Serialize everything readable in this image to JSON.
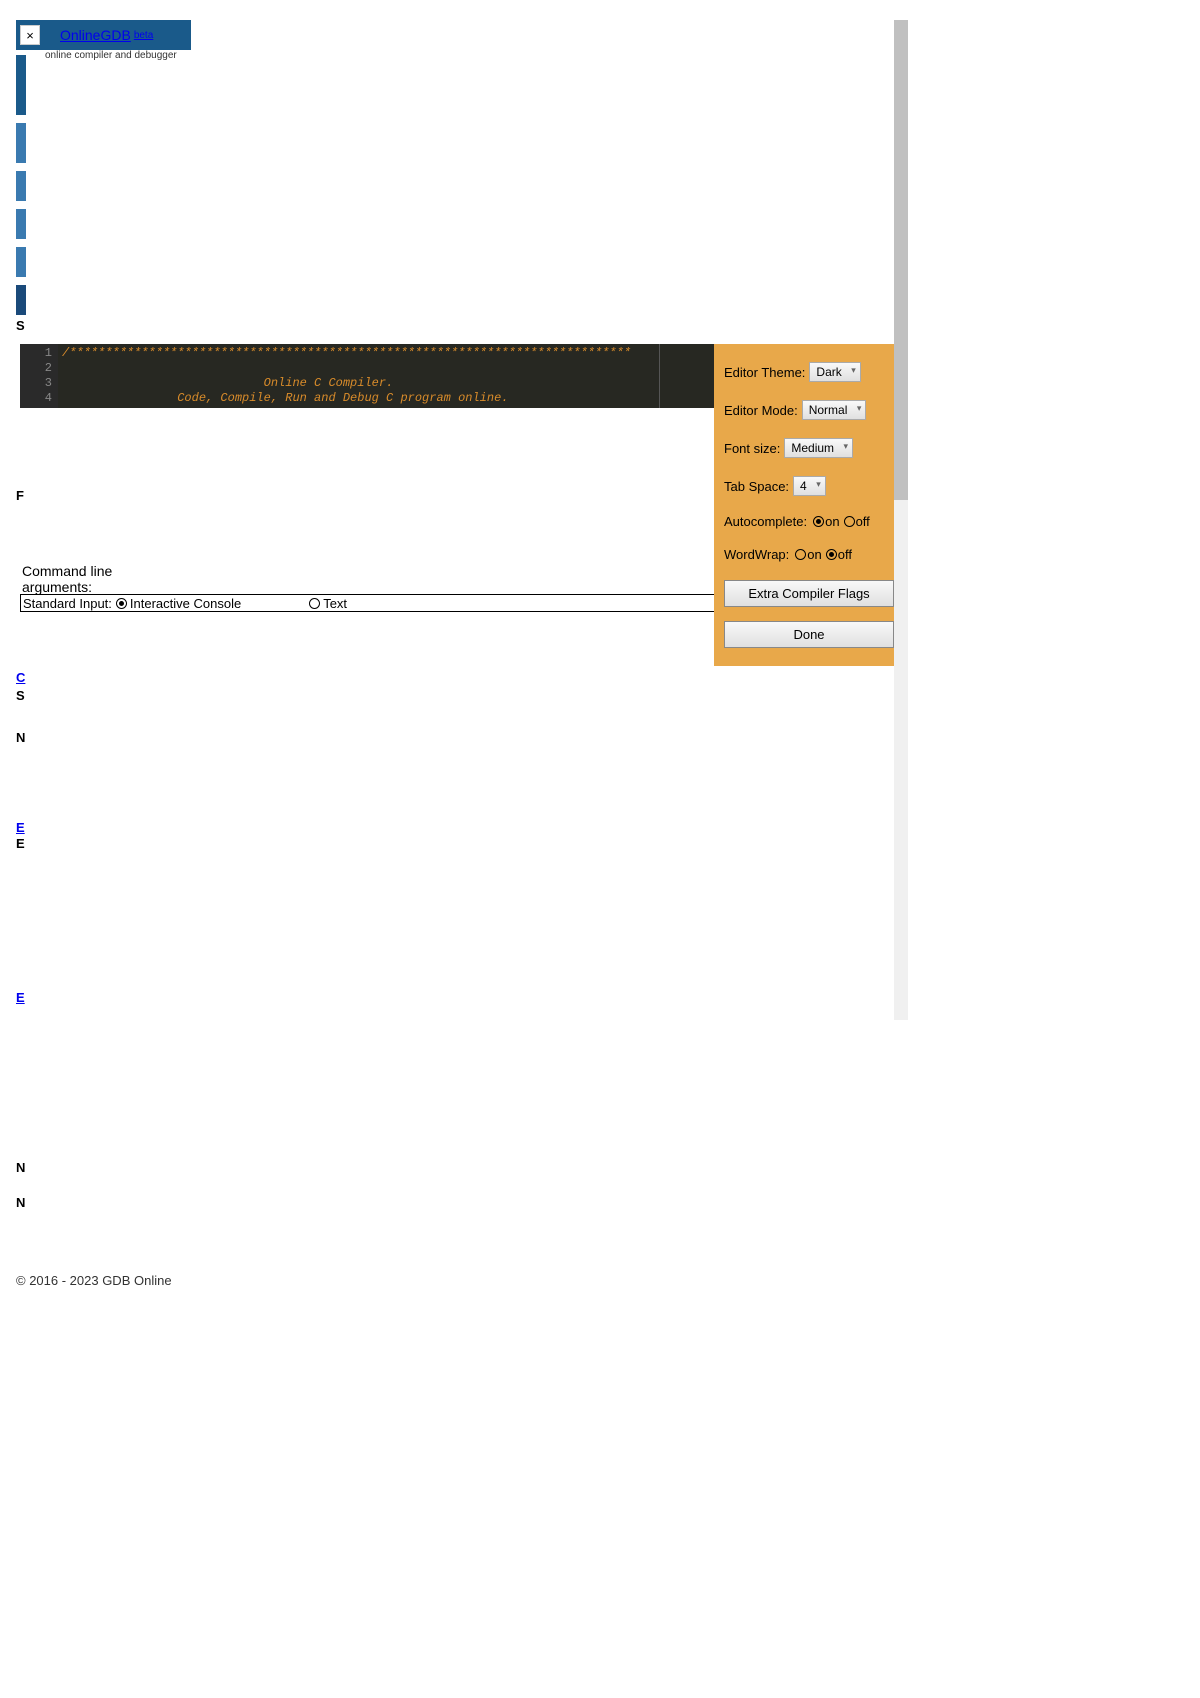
{
  "header": {
    "close_label": "×",
    "logo_text": "OnlineGDB",
    "beta_text": "beta",
    "subtitle": "online compiler and debugger"
  },
  "editor": {
    "line_numbers": [
      "1",
      "2",
      "3",
      "4"
    ],
    "code_line1": "/******************************************************************************",
    "code_line2": "",
    "code_line3": "                            Online C Compiler.",
    "code_line4": "                Code, Compile, Run and Debug C program online."
  },
  "cmd_section": {
    "cmd_label1": "Command line",
    "cmd_label2": "arguments:",
    "stdin_label": "Standard Input:",
    "radio_interactive": "Interactive Console",
    "radio_text": "Text"
  },
  "settings": {
    "theme_label": "Editor Theme:",
    "theme_value": "Dark",
    "mode_label": "Editor Mode:",
    "mode_value": "Normal",
    "font_label": "Font size:",
    "font_value": "Medium",
    "tab_label": "Tab Space:",
    "tab_value": "4",
    "autocomplete_label": "Autocomplete:",
    "wordwrap_label": "WordWrap:",
    "radio_on": "on",
    "radio_off": "off",
    "extra_flags_btn": "Extra Compiler Flags",
    "done_btn": "Done"
  },
  "misc": {
    "link_c": "C",
    "s_label": "S",
    "n_label": "N",
    "f_label": "F",
    "e_label": "E"
  },
  "footer": {
    "copyright": "© 2016 - 2023 GDB Online"
  }
}
